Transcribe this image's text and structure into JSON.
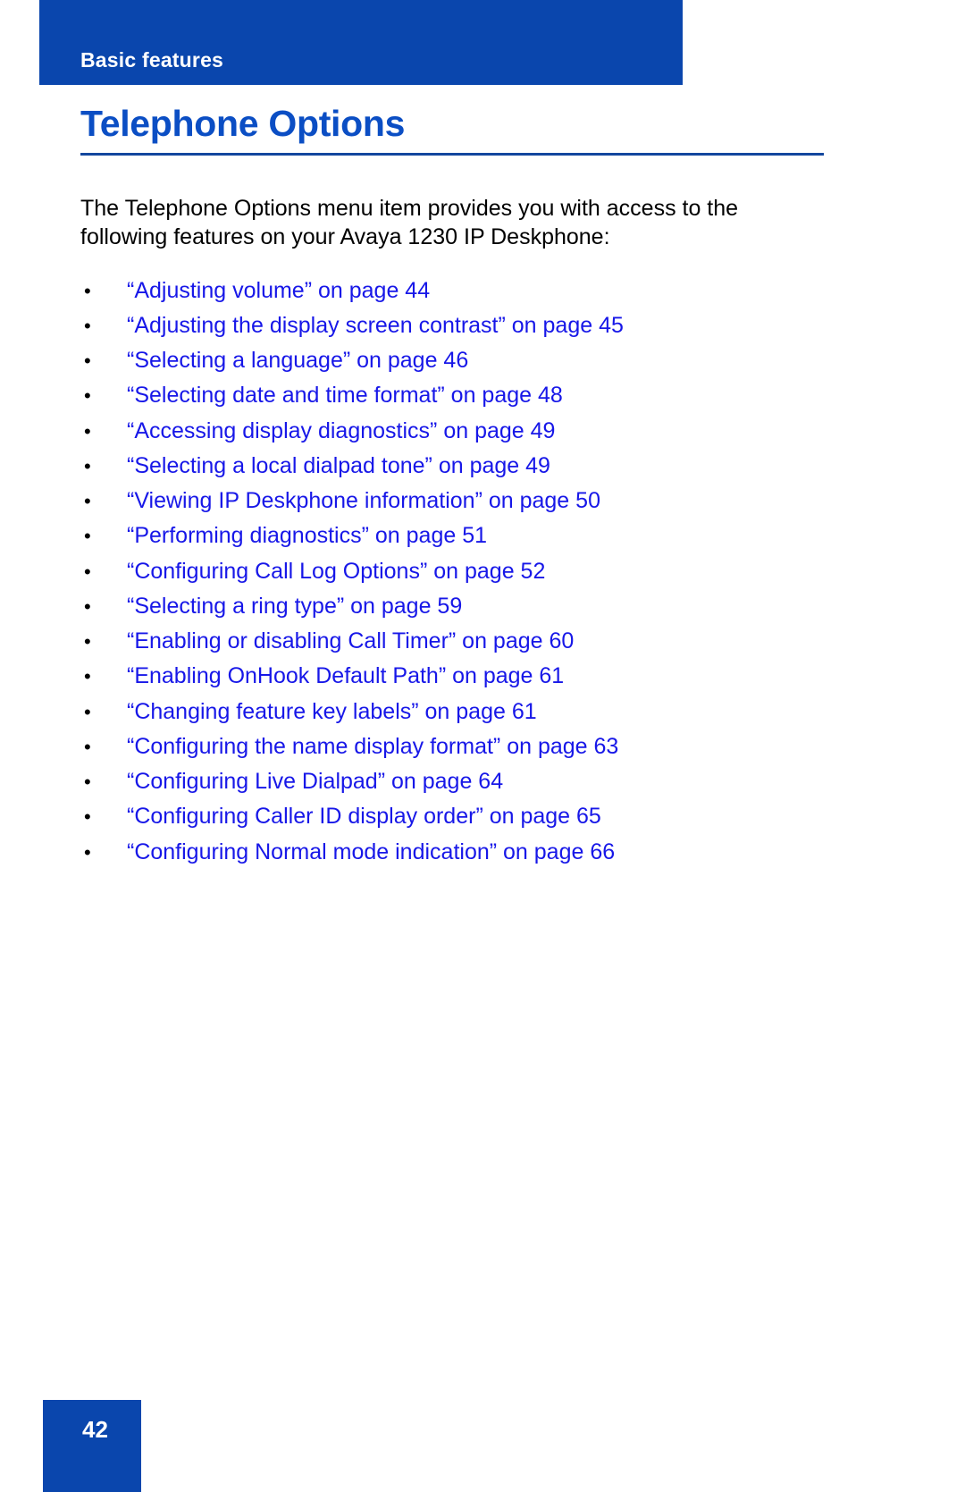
{
  "header": {
    "running_head": "Basic features"
  },
  "page": {
    "title": "Telephone Options",
    "intro": "The Telephone Options menu item provides you with access to the following features on your Avaya 1230 IP Deskphone:",
    "bullet_glyph": "•",
    "number": "42"
  },
  "colors": {
    "header_bar": "#0a46ad",
    "title_blue": "#0b4ec4",
    "rule_blue": "#13479e",
    "link_blue": "#1717e8",
    "body_black": "#000000",
    "page_background": "#ffffff"
  },
  "xref_list": [
    {
      "label": "“Adjusting volume” on page 44"
    },
    {
      "label": "“Adjusting the display screen contrast” on page 45"
    },
    {
      "label": "“Selecting a language” on page 46"
    },
    {
      "label": "“Selecting date and time format” on page 48"
    },
    {
      "label": "“Accessing display diagnostics” on page 49"
    },
    {
      "label": "“Selecting a local dialpad tone” on page 49"
    },
    {
      "label": "“Viewing IP Deskphone information” on page 50"
    },
    {
      "label": "“Performing diagnostics” on page 51"
    },
    {
      "label": "“Configuring Call Log Options” on page 52"
    },
    {
      "label": "“Selecting a ring type” on page 59"
    },
    {
      "label": "“Enabling or disabling Call Timer” on page 60"
    },
    {
      "label": "“Enabling OnHook Default Path” on page 61"
    },
    {
      "label": "“Changing feature key labels” on page 61"
    },
    {
      "label": "“Configuring the name display format” on page 63"
    },
    {
      "label": "“Configuring Live Dialpad” on page 64"
    },
    {
      "label": "“Configuring Caller ID display order” on page 65"
    },
    {
      "label": "“Configuring Normal mode indication” on page 66"
    }
  ]
}
